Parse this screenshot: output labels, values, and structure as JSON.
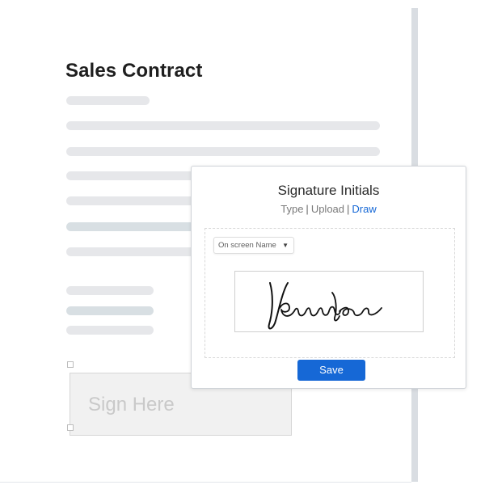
{
  "document": {
    "title": "Sales Contract"
  },
  "sign_here": {
    "label": "Sign Here"
  },
  "signature_modal": {
    "title": "Signature Initials",
    "modes": [
      {
        "label": "Type",
        "active": false
      },
      {
        "label": "Upload",
        "active": false
      },
      {
        "label": "Draw",
        "active": true
      }
    ],
    "separator": "|",
    "selected_option": "On screen Name",
    "save_label": "Save"
  },
  "colors": {
    "accent": "#1668d6",
    "placeholder_line": "#e6e7ea",
    "placeholder_line_dark": "#d8dfe3",
    "sign_here_text": "#c9c9c9"
  },
  "icons": {
    "dropdown": "chevron-down-icon"
  }
}
